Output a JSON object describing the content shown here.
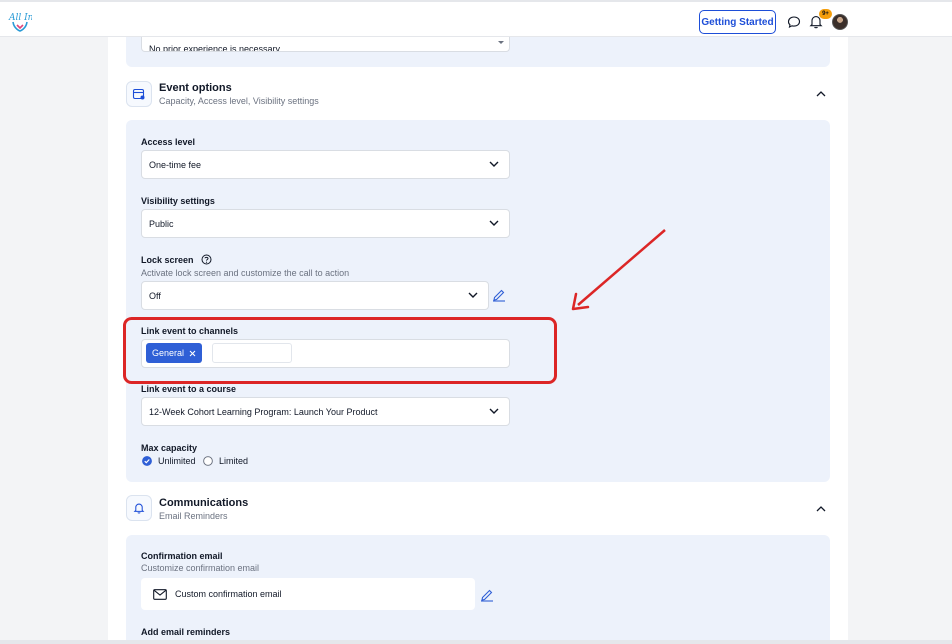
{
  "header": {
    "logo_text": "All In",
    "getting_started_label": "Getting Started",
    "notification_count": "9+"
  },
  "form": {
    "prev_dropdown_value": "No prior experience is necessary",
    "event_options": {
      "title": "Event options",
      "subtitle": "Capacity, Access level, Visibility settings",
      "access_level": {
        "label": "Access level",
        "value": "One-time fee"
      },
      "visibility": {
        "label": "Visibility settings",
        "value": "Public"
      },
      "lock_screen": {
        "label": "Lock screen",
        "helper": "Activate lock screen and customize the call to action",
        "value": "Off"
      },
      "link_channels": {
        "label": "Link event to channels",
        "chips": [
          "General"
        ],
        "input_value": ""
      },
      "link_course": {
        "label": "Link event to a course",
        "value": "12-Week Cohort Learning Program: Launch Your Product"
      },
      "max_capacity": {
        "label": "Max capacity",
        "options": [
          "Unlimited",
          "Limited"
        ],
        "selected": "Unlimited"
      }
    },
    "communications": {
      "title": "Communications",
      "subtitle": "Email Reminders",
      "confirmation": {
        "label": "Confirmation email",
        "helper": "Customize confirmation email",
        "row_label": "Custom confirmation email"
      },
      "reminders_label": "Add email reminders"
    }
  },
  "annotation": {
    "color": "#dc2626"
  }
}
